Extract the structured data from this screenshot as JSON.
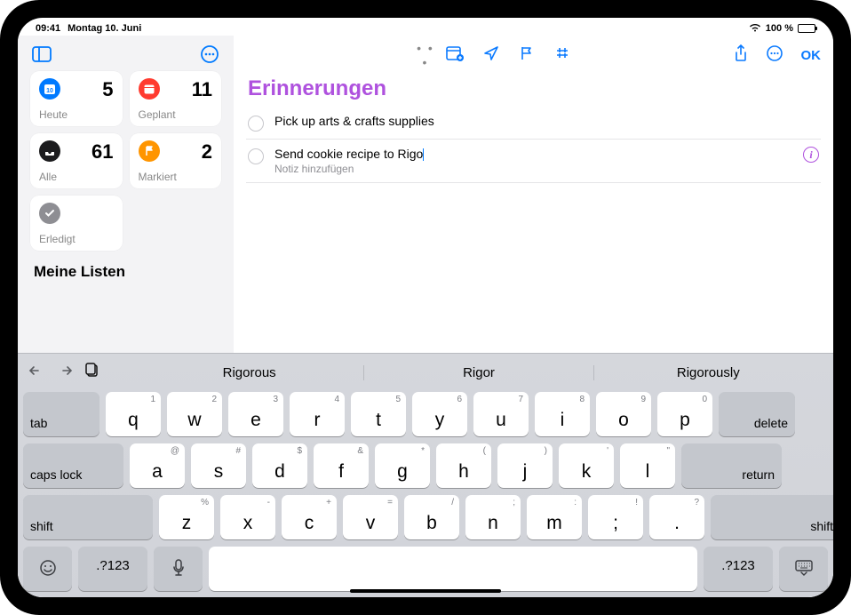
{
  "status": {
    "time": "09:41",
    "date": "Montag 10. Juni",
    "battery_pct": "100 %"
  },
  "handle_glyph": "• • •",
  "sidebar": {
    "tiles": [
      {
        "label": "Heute",
        "count": "5"
      },
      {
        "label": "Geplant",
        "count": "11"
      },
      {
        "label": "Alle",
        "count": "61"
      },
      {
        "label": "Markiert",
        "count": "2"
      },
      {
        "label": "Erledigt",
        "count": ""
      }
    ],
    "lists_header": "Meine Listen"
  },
  "toolbar": {
    "ok": "OK"
  },
  "list": {
    "title": "Erinnerungen",
    "items": [
      {
        "title": "Pick up arts & crafts supplies"
      },
      {
        "title": "Send cookie recipe to Rigo",
        "note": "Notiz hinzufügen"
      }
    ]
  },
  "keyboard": {
    "suggestions": [
      "Rigorous",
      "Rigor",
      "Rigorously"
    ],
    "row1": [
      {
        "k": "q",
        "s": "1"
      },
      {
        "k": "w",
        "s": "2"
      },
      {
        "k": "e",
        "s": "3"
      },
      {
        "k": "r",
        "s": "4"
      },
      {
        "k": "t",
        "s": "5"
      },
      {
        "k": "u",
        "s": "6"
      },
      {
        "k": "u",
        "s": "7"
      },
      {
        "k": "i",
        "s": "8"
      },
      {
        "k": "o",
        "s": "9"
      },
      {
        "k": "p",
        "s": "0"
      }
    ],
    "row1k": [
      "q",
      "w",
      "e",
      "r",
      "t",
      "u",
      "u",
      "i",
      "o",
      "p"
    ],
    "row1_real": [
      {
        "k": "q",
        "s": "1"
      },
      {
        "k": "w",
        "s": "2"
      },
      {
        "k": "e",
        "s": "3"
      },
      {
        "k": "r",
        "s": "4"
      },
      {
        "k": "t",
        "s": "5"
      },
      {
        "k": "u",
        "s": "6"
      },
      {
        "k": "u",
        "s": "7"
      },
      {
        "k": "i",
        "s": "8"
      },
      {
        "k": "o",
        "s": "9"
      },
      {
        "k": "p",
        "s": "0"
      }
    ],
    "r1": [
      {
        "k": "q",
        "s": "1"
      },
      {
        "k": "w",
        "s": "2"
      },
      {
        "k": "e",
        "s": "3"
      },
      {
        "k": "r",
        "s": "4"
      },
      {
        "k": "t",
        "s": "5"
      },
      {
        "k": "u",
        "s": "6"
      },
      {
        "k": "u",
        "s": "7"
      },
      {
        "k": "i",
        "s": "8"
      },
      {
        "k": "o",
        "s": "9"
      },
      {
        "k": "p",
        "s": "0"
      }
    ],
    "rows": {
      "r1": [
        {
          "k": "q",
          "s": "1"
        },
        {
          "k": "w",
          "s": "2"
        },
        {
          "k": "e",
          "s": "3"
        },
        {
          "k": "r",
          "s": "4"
        },
        {
          "k": "t",
          "s": "5"
        },
        {
          "k": "u",
          "s": "6"
        },
        {
          "k": "u",
          "s": "7"
        },
        {
          "k": "i",
          "s": "8"
        },
        {
          "k": "o",
          "s": "9"
        },
        {
          "k": "p",
          "s": "0"
        }
      ],
      "row1": [
        {
          "k": "q",
          "s": "1"
        },
        {
          "k": "w",
          "s": "2"
        },
        {
          "k": "e",
          "s": "3"
        },
        {
          "k": "r",
          "s": "4"
        },
        {
          "k": "t",
          "s": "5"
        },
        {
          "k": "u",
          "s": "6"
        },
        {
          "k": "u",
          "s": "7"
        },
        {
          "k": "i",
          "s": "8"
        },
        {
          "k": "o",
          "s": "9"
        },
        {
          "k": "p",
          "s": "0"
        }
      ]
    },
    "tab": "tab",
    "delete": "delete",
    "caps": "caps lock",
    "return": "return",
    "shift": "shift",
    "numswitch": ".?123",
    "row1_keys": [
      "q",
      "w",
      "e",
      "r",
      "t",
      "u",
      "u",
      "i",
      "o",
      "p"
    ],
    "row1_subs": [
      "1",
      "2",
      "3",
      "4",
      "5",
      "6",
      "7",
      "8",
      "9",
      "0"
    ],
    "row2_keys": [
      "a",
      "s",
      "d",
      "f",
      "g",
      "h",
      "j",
      "k",
      "l"
    ],
    "row2_subs": [
      "@",
      "#",
      "$",
      "&",
      "*",
      "(",
      ")",
      "'",
      "\""
    ],
    "row3_keys": [
      "z",
      "x",
      "c",
      "v",
      "b",
      "n",
      "m",
      ",",
      "."
    ],
    "row3_subs": [
      "%",
      "-",
      "+",
      "=",
      "/",
      ";",
      ":",
      "!",
      "?"
    ],
    "row3_display_last2": [
      ";",
      "."
    ],
    "row3_main": [
      "z",
      "x",
      "c",
      "v",
      "b",
      "n",
      "m"
    ],
    "row3_punct": [
      {
        "k": ";",
        "s": "!"
      },
      {
        "k": ".",
        "s": "?"
      }
    ]
  }
}
